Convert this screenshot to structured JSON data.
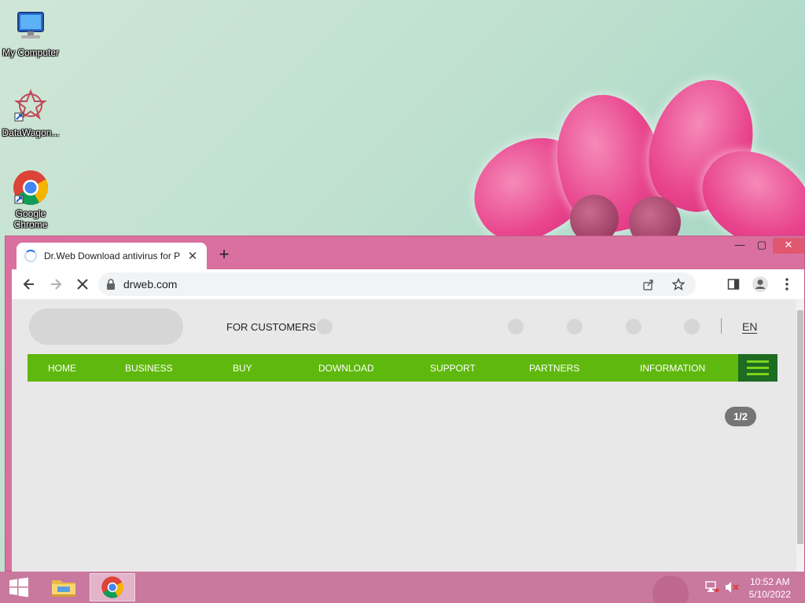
{
  "desktop": {
    "icons": [
      {
        "label": "My Computer",
        "icon": "computer-icon"
      },
      {
        "label": "DataWagon...",
        "icon": "datawagon-icon"
      },
      {
        "label": "Google Chrome",
        "icon": "chrome-icon"
      }
    ]
  },
  "browser": {
    "tab": {
      "title": "Dr.Web Download antivirus for P",
      "close_label": "✕",
      "loading": true
    },
    "new_tab_label": "+",
    "window_controls": {
      "minimize": "—",
      "maximize": "▢",
      "close": "✕"
    },
    "address": {
      "url": "drweb.com",
      "lock_icon": "lock-icon"
    },
    "toolbar_icons": [
      "back-icon",
      "forward-icon",
      "stop-icon",
      "share-icon",
      "bookmark-star-icon",
      "side-panel-icon",
      "profile-icon",
      "menu-icon"
    ]
  },
  "page": {
    "header": {
      "for_customers": "FOR CUSTOMERS",
      "language": "EN"
    },
    "nav": {
      "items": [
        "HOME",
        "BUSINESS",
        "BUY",
        "DOWNLOAD",
        "SUPPORT",
        "PARTNERS",
        "INFORMATION"
      ]
    },
    "slider_pager": "1/2"
  },
  "taskbar": {
    "apps": [
      "file-explorer-icon",
      "chrome-icon"
    ],
    "tray": [
      "network-icon",
      "volume-muted-icon"
    ],
    "time": "10:52 AM",
    "date": "5/10/2022"
  },
  "colors": {
    "nav_green": "#5fb80e",
    "burger_dark_green": "#1e6b22",
    "window_frame": "#d9709f",
    "taskbar": "#c9789e"
  }
}
